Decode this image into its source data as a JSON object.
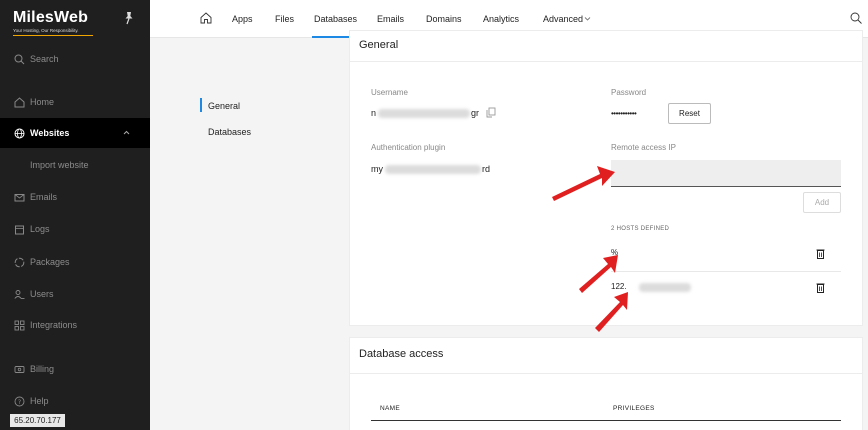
{
  "sidebar": {
    "logo": "MilesWeb",
    "tagline": "Your Hosting, Our Responsibility.",
    "items": [
      {
        "label": "Search",
        "icon": "search-icon"
      },
      {
        "label": "Home",
        "icon": "home-icon"
      },
      {
        "label": "Websites",
        "icon": "globe-icon",
        "active": true
      },
      {
        "label": "Import website",
        "sub": true
      },
      {
        "label": "Emails",
        "icon": "mail-icon"
      },
      {
        "label": "Logs",
        "icon": "calendar-icon"
      },
      {
        "label": "Packages",
        "icon": "circle-icon"
      },
      {
        "label": "Users",
        "icon": "users-icon"
      },
      {
        "label": "Integrations",
        "icon": "grid-icon"
      },
      {
        "label": "Billing",
        "icon": "card-icon"
      },
      {
        "label": "Help",
        "icon": "help-icon"
      }
    ],
    "ip": "65.20.70.177"
  },
  "topnav": {
    "items": [
      "Apps",
      "Files",
      "Databases",
      "Emails",
      "Domains",
      "Analytics",
      "Advanced"
    ],
    "active": "Databases"
  },
  "subnav": {
    "items": [
      "General",
      "Databases"
    ]
  },
  "general": {
    "title": "General",
    "username_label": "Username",
    "username_value_start": "n",
    "username_value_end": "gr",
    "password_label": "Password",
    "password_value": "•••••••••••",
    "reset_label": "Reset",
    "auth_label": "Authentication plugin",
    "auth_value_start": "my",
    "auth_value_end": "rd",
    "remote_label": "Remote access IP",
    "remote_value": "",
    "add_label": "Add",
    "hosts_defined": "2 HOSTS DEFINED",
    "hosts": [
      "%",
      "122."
    ]
  },
  "db_access": {
    "title": "Database access",
    "col_name": "NAME",
    "col_privileges": "PRIVILEGES"
  },
  "colors": {
    "accent": "#1e88e5",
    "sidebar_bg": "#1f1f1f",
    "arrow": "#e02020"
  }
}
